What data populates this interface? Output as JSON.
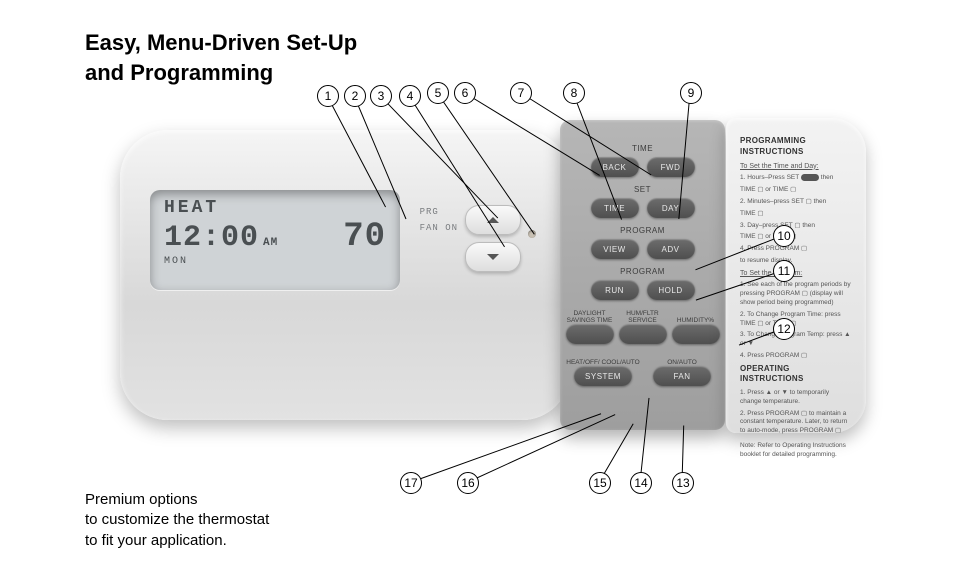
{
  "heading_line1": "Easy, Menu-Driven Set-Up",
  "heading_line2": "and Programming",
  "caption_line1": "Premium options",
  "caption_line2": "to customize the thermostat",
  "caption_line3": "to fit your application.",
  "lcd": {
    "mode": "HEAT",
    "time": "12:00",
    "ampm": "AM",
    "temp": "70",
    "day": "MON",
    "side1": "PRG",
    "side2": "FAN ON"
  },
  "panel": {
    "sec_time": "TIME",
    "back": "BACK",
    "fwd": "FWD",
    "sec_set": "SET",
    "time_btn": "TIME",
    "day_btn": "DAY",
    "sec_program1": "PROGRAM",
    "view": "VIEW",
    "adv": "ADV",
    "sec_program2": "PROGRAM",
    "run": "RUN",
    "hold": "HOLD",
    "cap_dst": "DAYLIGHT\nSAVINGS TIME",
    "cap_hf": "HUM/FLTR\nSERVICE",
    "cap_hum": "HUMIDITY%",
    "cap_mode": "HEAT/OFF/\nCOOL/AUTO",
    "cap_fan": "ON/AUTO",
    "system": "SYSTEM",
    "fan": "FAN"
  },
  "cover": {
    "title": "PROGRAMMING INSTRUCTIONS",
    "set_hdr": "To Set the Time and Day:",
    "s1": "1. Hours–Press SET",
    "s1b": "TIME ▢ or TIME ▢",
    "s2": "2. Minutes–press SET ▢ then",
    "s2b": "TIME ▢",
    "s3": "3. Day–press SET ▢ then",
    "s3b": "TIME ▢ or TIME ▢",
    "s4": "4. Press PROGRAM ▢",
    "s4b": "to resume display.",
    "ph": "To Set the Program:",
    "p1": "1. See each of the program periods by pressing PROGRAM ▢ (display will show period being programmed)",
    "p2": "2. To Change Program Time: press TIME ▢ or TIME ▢",
    "p3": "3. To Change Program Temp: press ▲ or ▼",
    "p4": "4. Press PROGRAM ▢",
    "oh": "OPERATING INSTRUCTIONS",
    "o1": "1. Press ▲ or ▼ to temporarily change temperature.",
    "o2": "2. Press PROGRAM ▢ to maintain a constant temperature. Later, to return to auto-mode, press PROGRAM ▢",
    "note": "Note: Refer to Operating Instructions booklet for detailed programming."
  },
  "callouts": [
    "1",
    "2",
    "3",
    "4",
    "5",
    "6",
    "7",
    "8",
    "9",
    "10",
    "11",
    "12",
    "13",
    "14",
    "15",
    "16",
    "17"
  ]
}
